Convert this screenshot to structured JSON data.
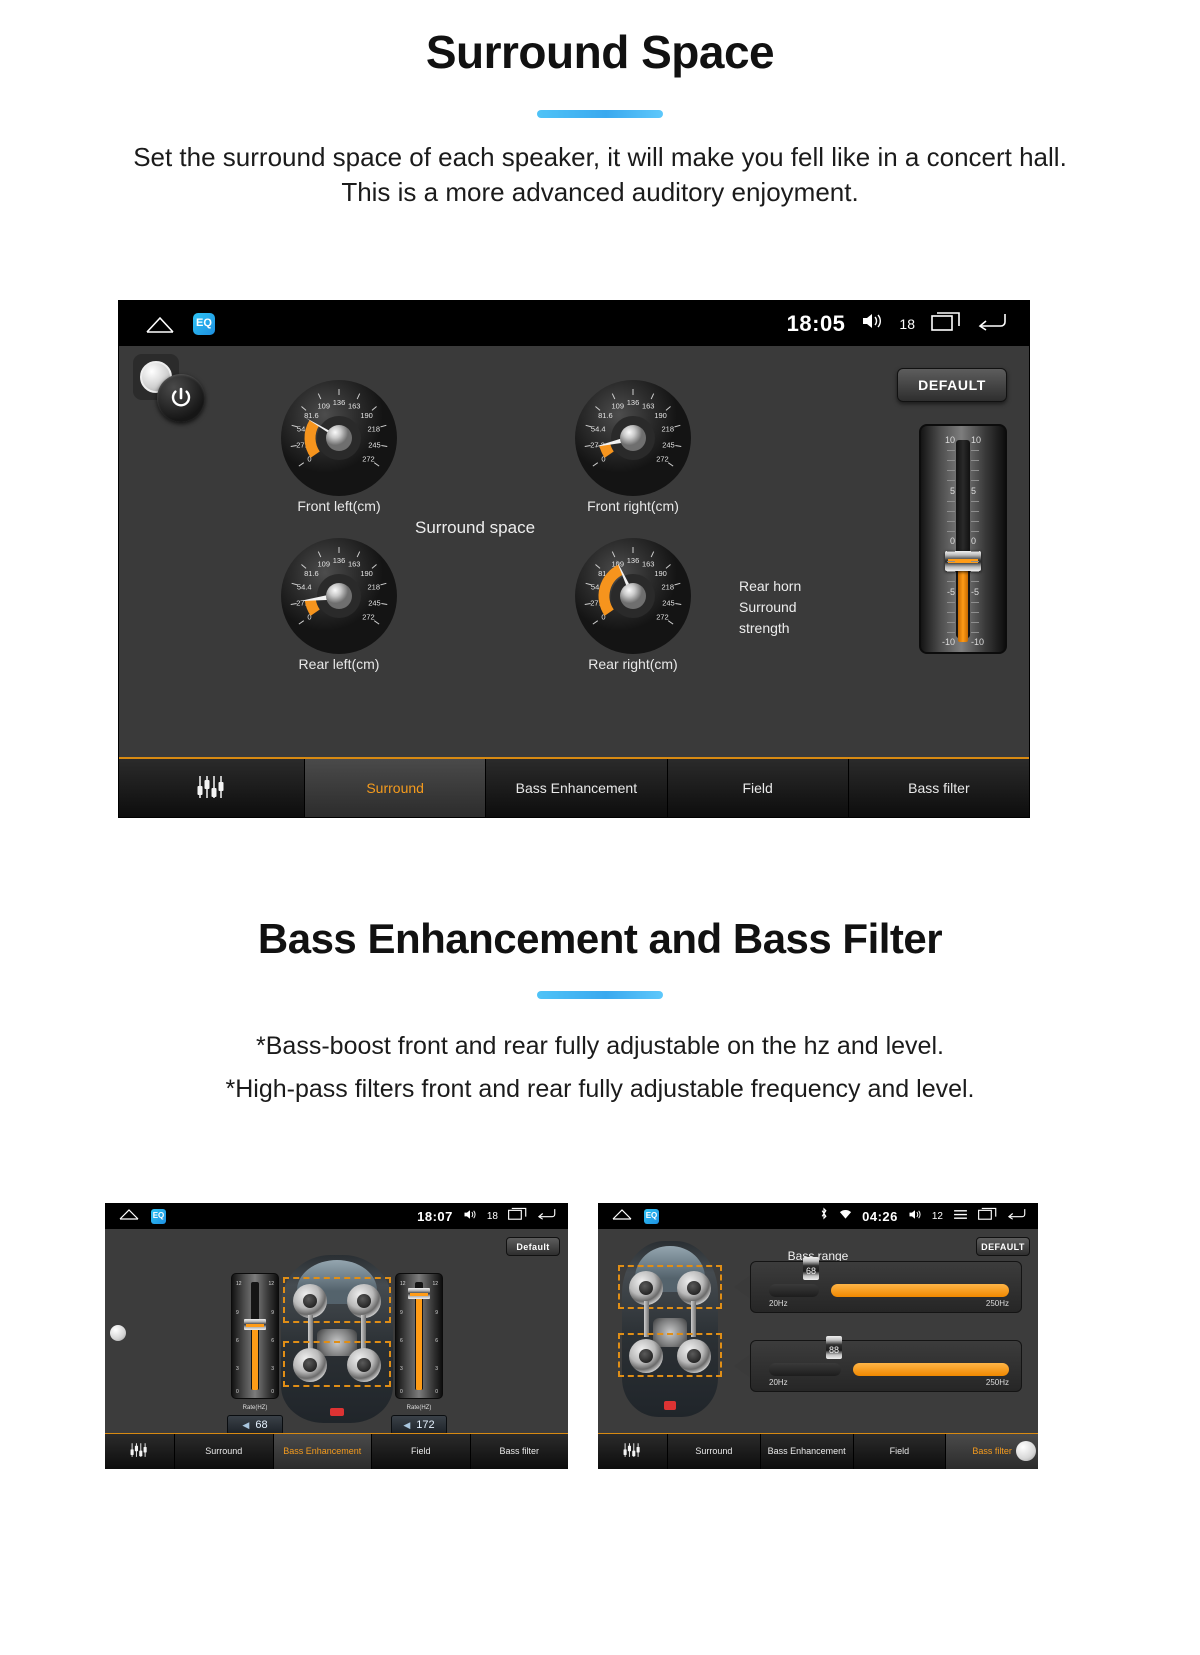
{
  "sections": [
    {
      "title": "Surround Space",
      "description_lines": [
        "Set the surround space of each speaker, it will make you fell like in a concert hall.",
        "This is a more advanced auditory enjoyment."
      ]
    },
    {
      "title": "Bass Enhancement and Bass Filter",
      "description_lines": [
        "*Bass-boost front and rear fully adjustable on the hz and level.",
        "*High-pass filters front and rear fully adjustable frequency and level."
      ]
    }
  ],
  "main_screen": {
    "statusbar": {
      "home_icon": "home-icon",
      "app_icon": "equalizer-app-icon",
      "time": "18:05",
      "volume_icon": "volume-icon",
      "volume_level": "18",
      "recents_icon": "recents-icon",
      "back_icon": "back-icon"
    },
    "power_button_icon": "power-icon",
    "center_label": "Surround space",
    "default_button": "DEFAULT",
    "rear_horn_label_lines": [
      "Rear horn",
      "Surround",
      "strength"
    ],
    "knobs": [
      {
        "id": "front-left",
        "label": "Front left(cm)",
        "value": 72,
        "needle_deg": -62
      },
      {
        "id": "front-right",
        "label": "Front right(cm)",
        "value": 24,
        "needle_deg": -115
      },
      {
        "id": "rear-left",
        "label": "Rear left(cm)",
        "value": 30,
        "needle_deg": -105
      },
      {
        "id": "rear-right",
        "label": "Rear right(cm)",
        "value": 109,
        "needle_deg": -16
      }
    ],
    "knob_scale": {
      "ticks": [
        "0",
        "27.2",
        "54.4",
        "81.6",
        "109",
        "136",
        "163",
        "190",
        "218",
        "245",
        "272"
      ],
      "min": 0,
      "max": 272,
      "unit": "cm"
    },
    "strength_slider": {
      "ticks": [
        "10",
        "5",
        "0",
        "-5",
        "-10"
      ],
      "min": -10,
      "max": 10,
      "value": -2
    },
    "tabs": [
      {
        "id": "equalizer",
        "label": "",
        "icon": "equalizer-icon",
        "active": false
      },
      {
        "id": "surround",
        "label": "Surround",
        "active": true
      },
      {
        "id": "bass-enhancement",
        "label": "Bass Enhancement",
        "active": false
      },
      {
        "id": "field",
        "label": "Field",
        "active": false
      },
      {
        "id": "bass-filter",
        "label": "Bass filter",
        "active": false
      }
    ]
  },
  "bass_enhancement_screen": {
    "statusbar": {
      "time": "18:07",
      "volume_level": "18"
    },
    "default_button": "Default",
    "left_fader": {
      "caption": "Rate(HZ)",
      "value": "68",
      "ticks": [
        "12",
        "9",
        "6",
        "3",
        "0"
      ],
      "level": 0.58
    },
    "right_fader": {
      "caption": "Rate(HZ)",
      "value": "172",
      "ticks": [
        "12",
        "9",
        "6",
        "3",
        "0"
      ],
      "level": 0.82
    },
    "tabs": [
      {
        "id": "equalizer",
        "label": "",
        "icon": "equalizer-icon",
        "active": false
      },
      {
        "id": "surround",
        "label": "Surround",
        "active": false
      },
      {
        "id": "bass-enhancement",
        "label": "Bass Enhancement",
        "active": true
      },
      {
        "id": "field",
        "label": "Field",
        "active": false
      },
      {
        "id": "bass-filter",
        "label": "Bass filter",
        "active": false
      }
    ]
  },
  "bass_filter_screen": {
    "statusbar": {
      "bluetooth_icon": "bluetooth-icon",
      "wifi_icon": "wifi-icon",
      "time": "04:26",
      "volume_level": "12",
      "menu_icon": "menu-icon",
      "recents_icon": "recents-icon",
      "back_icon": "back-icon"
    },
    "default_button": "DEFAULT",
    "title": "Bass range",
    "sliders": [
      {
        "id": "front",
        "value": "68",
        "min_label": "20Hz",
        "max_label": "250Hz",
        "position": 0.21
      },
      {
        "id": "rear",
        "value": "88",
        "min_label": "20Hz",
        "max_label": "250Hz",
        "position": 0.3
      }
    ],
    "tabs": [
      {
        "id": "equalizer",
        "label": "",
        "icon": "equalizer-icon",
        "active": false
      },
      {
        "id": "surround",
        "label": "Surround",
        "active": false
      },
      {
        "id": "bass-enhancement",
        "label": "Bass Enhancement",
        "active": false
      },
      {
        "id": "field",
        "label": "Field",
        "active": false
      },
      {
        "id": "bass-filter",
        "label": "Bass filter",
        "active": true
      }
    ]
  },
  "colors": {
    "accent_orange": "#f59b1d",
    "rule_blue": "#4fc3f7",
    "screen_bg": "#3a3a3a"
  }
}
